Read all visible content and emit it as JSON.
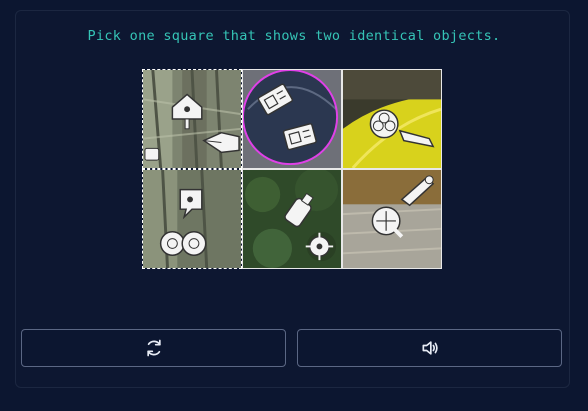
{
  "prompt": "Pick one square that shows two identical objects.",
  "grid": {
    "tiles": [
      {
        "icons": [
          "birdhouse-icon",
          "pen-nib-icon",
          "small-badge-icon"
        ],
        "background": "tree-bark"
      },
      {
        "icons": [
          "ticket-icon",
          "ticket-icon"
        ],
        "background": "dark-glass",
        "marked": true
      },
      {
        "icons": [
          "flower-icon",
          "pencil-icon"
        ],
        "background": "yellow-leaf"
      },
      {
        "icons": [
          "speech-bubble-icon",
          "binoculars-icon"
        ],
        "background": "tree-moss"
      },
      {
        "icons": [
          "bottle-icon",
          "crosshair-icon"
        ],
        "background": "green-foliage"
      },
      {
        "icons": [
          "brush-icon",
          "magnifier-icon"
        ],
        "background": "dry-grass"
      }
    ]
  },
  "controls": {
    "refresh_icon": "refresh-icon",
    "audio_icon": "speaker-icon"
  },
  "colors": {
    "background": "#0c1630",
    "prompt": "#35c4b6",
    "highlight": "#e040e8"
  }
}
